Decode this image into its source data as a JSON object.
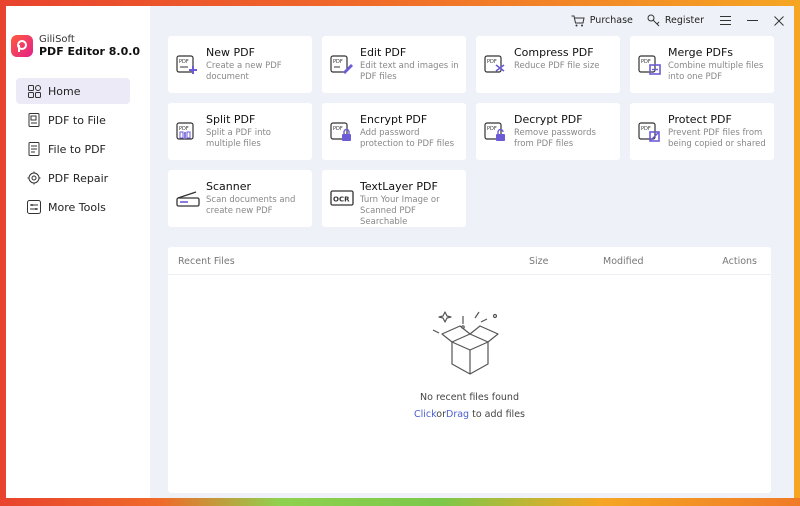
{
  "brand": {
    "company": "GiliSoft",
    "product": "PDF Editor 8.0.0"
  },
  "nav": [
    {
      "label": "Home",
      "icon": "home-icon",
      "active": true
    },
    {
      "label": "PDF to File",
      "icon": "pdf-to-file-icon"
    },
    {
      "label": "File to  PDF",
      "icon": "file-to-pdf-icon"
    },
    {
      "label": "PDF Repair",
      "icon": "repair-icon"
    },
    {
      "label": "More Tools",
      "icon": "more-tools-icon"
    }
  ],
  "topbar": {
    "purchase": "Purchase",
    "register": "Register"
  },
  "tools": [
    {
      "title": "New PDF",
      "desc": "Create a new PDF document"
    },
    {
      "title": "Edit PDF",
      "desc": "Edit text and images in PDF files"
    },
    {
      "title": "Compress PDF",
      "desc": "Reduce PDF file size"
    },
    {
      "title": "Merge PDFs",
      "desc": "Combine multiple files into one PDF"
    },
    {
      "title": "Split PDF",
      "desc": "Split a PDF into multiple files"
    },
    {
      "title": "Encrypt PDF",
      "desc": "Add password protection to PDF files"
    },
    {
      "title": "Decrypt PDF",
      "desc": "Remove passwords from PDF files"
    },
    {
      "title": "Protect PDF",
      "desc": "Prevent PDF files from being copied or shared"
    },
    {
      "title": "Scanner",
      "desc": "Scan documents and create new PDF"
    },
    {
      "title": "TextLayer PDF",
      "desc": "Turn Your Image or Scanned PDF Searchable"
    }
  ],
  "recent": {
    "col_name": "Recent Files",
    "col_size": "Size",
    "col_modified": "Modified",
    "col_actions": "Actions",
    "empty_text": "No recent files found",
    "hint_click": "Click",
    "hint_or": "or",
    "hint_drag": "Drag",
    "hint_rest": " to add files"
  },
  "colors": {
    "accent": "#6b5bd6",
    "link": "#4a5fd0",
    "brand_gradient_start": "#ff5a3c",
    "brand_gradient_end": "#e3208a"
  }
}
